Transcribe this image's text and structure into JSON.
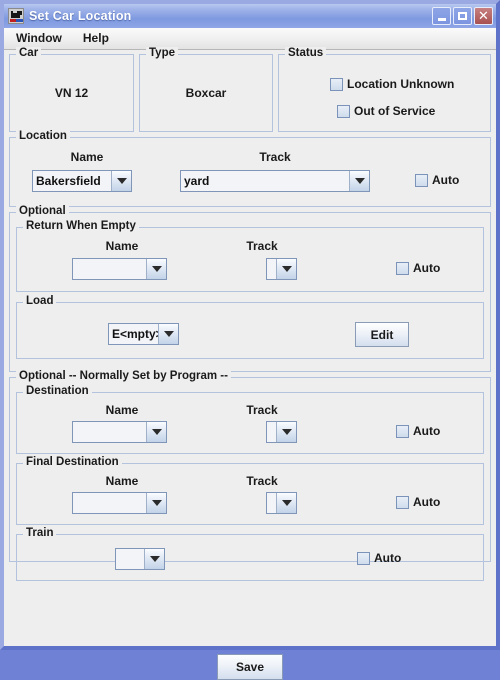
{
  "window": {
    "title": "Set Car Location",
    "icon": "locomotive-icon",
    "buttons": {
      "minimize": "minimize-icon",
      "maximize": "maximize-icon",
      "close": "close-icon"
    },
    "border_color": "#6f81d4",
    "titlebar_color": "#8fa6e6"
  },
  "menubar": {
    "items": [
      {
        "label": "Window"
      },
      {
        "label": "Help"
      }
    ]
  },
  "car": {
    "legend": "Car",
    "value": "VN 12"
  },
  "type": {
    "legend": "Type",
    "value": "Boxcar"
  },
  "status": {
    "legend": "Status",
    "checkboxes": [
      {
        "label": "Location Unknown",
        "checked": false
      },
      {
        "label": "Out of Service",
        "checked": false
      }
    ]
  },
  "location": {
    "legend": "Location",
    "name_label": "Name",
    "track_label": "Track",
    "name_value": "Bakersfield",
    "track_value": "yard",
    "auto_label": "Auto",
    "auto_checked": false
  },
  "optional": {
    "legend": "Optional",
    "return_when_empty": {
      "legend": "Return When Empty",
      "name_label": "Name",
      "track_label": "Track",
      "name_value": "",
      "track_value": "",
      "auto_label": "Auto",
      "auto_checked": false
    },
    "load": {
      "legend": "Load",
      "value": "E<mpty>",
      "edit_label": "Edit"
    }
  },
  "optional_program": {
    "legend": "Optional -- Normally Set by Program --",
    "destination": {
      "legend": "Destination",
      "name_label": "Name",
      "track_label": "Track",
      "name_value": "",
      "track_value": "",
      "auto_label": "Auto",
      "auto_checked": false
    },
    "final_destination": {
      "legend": "Final Destination",
      "name_label": "Name",
      "track_label": "Track",
      "name_value": "",
      "track_value": "",
      "auto_label": "Auto",
      "auto_checked": false
    },
    "train": {
      "legend": "Train",
      "value": "",
      "auto_label": "Auto",
      "auto_checked": false
    }
  },
  "footer": {
    "save_label": "Save"
  }
}
